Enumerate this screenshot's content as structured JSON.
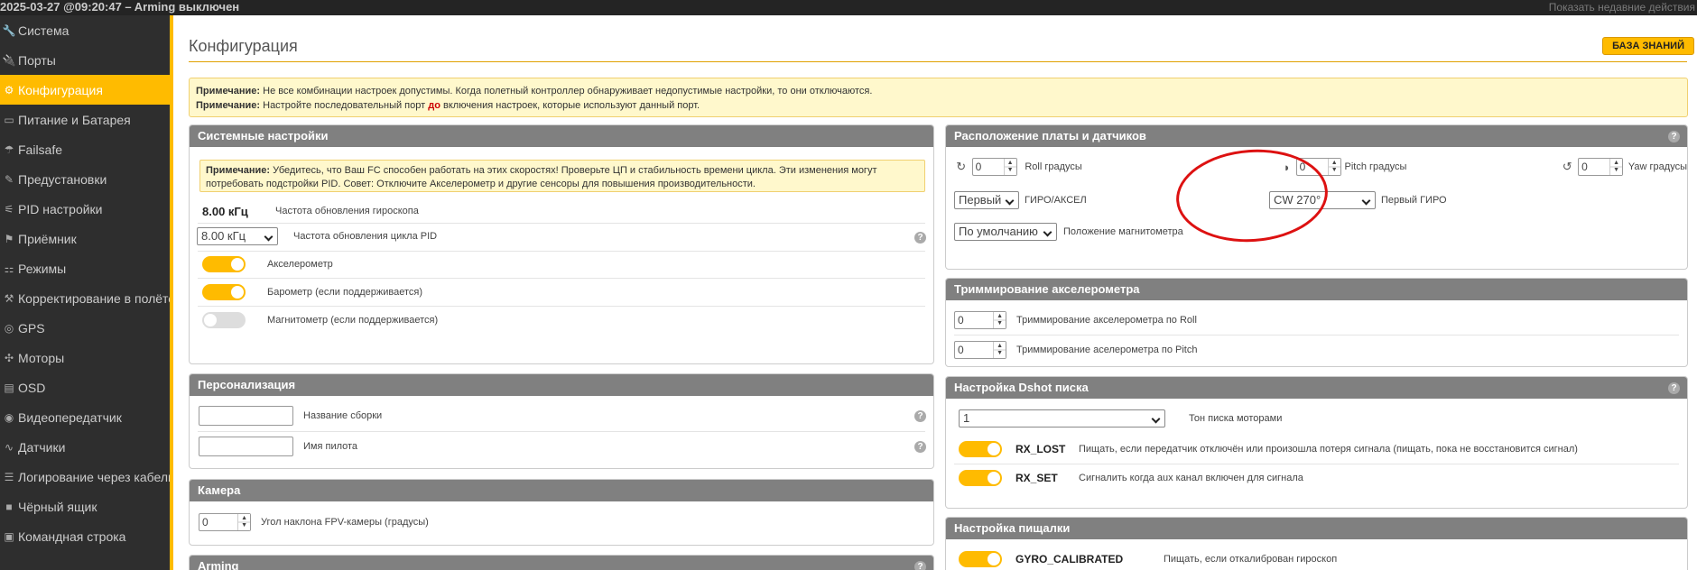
{
  "topbar": {
    "title": "2025-03-27 @09:20:47 – Arming выключен",
    "recent": "Показать недавние действия"
  },
  "sidebar": {
    "items": [
      {
        "label": "Система",
        "icon": "wrench-icon",
        "glyph": "🔧",
        "active": false
      },
      {
        "label": "Порты",
        "icon": "plug-icon",
        "glyph": "🔌",
        "active": false
      },
      {
        "label": "Конфигурация",
        "icon": "gear-icon",
        "glyph": "⚙",
        "active": true
      },
      {
        "label": "Питание и Батарея",
        "icon": "battery-icon",
        "glyph": "▭",
        "active": false
      },
      {
        "label": "Failsafe",
        "icon": "parachute-icon",
        "glyph": "☂",
        "active": false
      },
      {
        "label": "Предустановки",
        "icon": "magic-wand-icon",
        "glyph": "✎",
        "active": false
      },
      {
        "label": "PID настройки",
        "icon": "sliders-icon",
        "glyph": "⚟",
        "active": false
      },
      {
        "label": "Приёмник",
        "icon": "receiver-icon",
        "glyph": "⚑",
        "active": false
      },
      {
        "label": "Режимы",
        "icon": "modes-icon",
        "glyph": "⚏",
        "active": false
      },
      {
        "label": "Корректирование в полёте",
        "icon": "adjustments-icon",
        "glyph": "⚒",
        "active": false
      },
      {
        "label": "GPS",
        "icon": "gps-icon",
        "glyph": "◎",
        "active": false
      },
      {
        "label": "Моторы",
        "icon": "motor-icon",
        "glyph": "✣",
        "active": false
      },
      {
        "label": "OSD",
        "icon": "osd-icon",
        "glyph": "▤",
        "active": false
      },
      {
        "label": "Видеопередатчик",
        "icon": "video-transmitter-icon",
        "glyph": "◉",
        "active": false
      },
      {
        "label": "Датчики",
        "icon": "sensors-icon",
        "glyph": "∿",
        "active": false
      },
      {
        "label": "Логирование через кабель",
        "icon": "cable-log-icon",
        "glyph": "☰",
        "active": false
      },
      {
        "label": "Чёрный ящик",
        "icon": "blackbox-icon",
        "glyph": "■",
        "active": false
      },
      {
        "label": "Командная строка",
        "icon": "terminal-icon",
        "glyph": "▣",
        "active": false
      }
    ]
  },
  "page": {
    "title": "Конфигурация",
    "wiki_label": "БАЗА ЗНАНИЙ"
  },
  "top_note": {
    "label1": "Примечание:",
    "text1": " Не все комбинации настроек допустимы. Когда полетный контроллер обнаруживает недопустимые настройки, то они отключаются.",
    "label2": "Примечание:",
    "text2a": " Настройте последовательный порт ",
    "text2b": "до",
    "text2c": " включения настроек, которые используют данный порт."
  },
  "system": {
    "title": "Системные настройки",
    "note_label": "Примечание:",
    "note_text": " Убедитесь, что Ваш FC способен работать на этих скоростях! Проверьте ЦП и стабильность времени цикла. Эти изменения могут потребовать подстройки PID. Совет: Отключите Акселерометр и другие сенсоры для повышения производительности.",
    "gyro_value": "8.00 кГц",
    "gyro_label": "Частота обновления гироскопа",
    "pid_value": "8.00 кГц",
    "pid_label": "Частота обновления цикла PID",
    "accel_label": "Акселерометр",
    "baro_label": "Барометр (если поддерживается)",
    "mag_label": "Магнитометр (если поддерживается)"
  },
  "personal": {
    "title": "Персонализация",
    "craft_label": "Название сборки",
    "pilot_label": "Имя пилота"
  },
  "camera": {
    "title": "Камера",
    "angle_value": "0",
    "angle_label": "Угол наклона FPV-камеры (градусы)"
  },
  "arming": {
    "title": "Arming"
  },
  "board": {
    "title": "Расположение платы и датчиков",
    "roll_value": "0",
    "roll_label": "Roll градусы",
    "pitch_value": "0",
    "pitch_label": "Pitch градусы",
    "yaw_value": "0",
    "yaw_label": "Yaw градусы",
    "gyro_select": "Первый",
    "gyro_select_label": "ГИРО/АКСЕЛ",
    "align_select": "CW 270°",
    "align_label": "Первый ГИРО",
    "mag_select": "По умолчанию",
    "mag_label": "Положение магнитометра"
  },
  "trim": {
    "title": "Триммирование акселерометра",
    "roll_value": "0",
    "roll_label": "Триммирование акселерометра по Roll",
    "pitch_value": "0",
    "pitch_label": "Триммирование аселерометра по Pitch"
  },
  "dshot": {
    "title": "Настройка Dshot писка",
    "tone_value": "1",
    "tone_label": "Тон писка моторами",
    "rx_lost": "RX_LOST",
    "rx_lost_desc": "Пищать, если передатчик отключён или произошла потеря сигнала (пищать, пока не восстановится сигнал)",
    "rx_set": "RX_SET",
    "rx_set_desc": "Сигналить когда aux канал включен для сигнала"
  },
  "beeper": {
    "title": "Настройка пищалки",
    "gyro_cal": "GYRO_CALIBRATED",
    "gyro_cal_desc": "Пищать, если откалиброван гироскоп"
  },
  "colors": {
    "accent": "#ffbb00",
    "panel_header": "#808080",
    "annotation": "#dd1111"
  }
}
